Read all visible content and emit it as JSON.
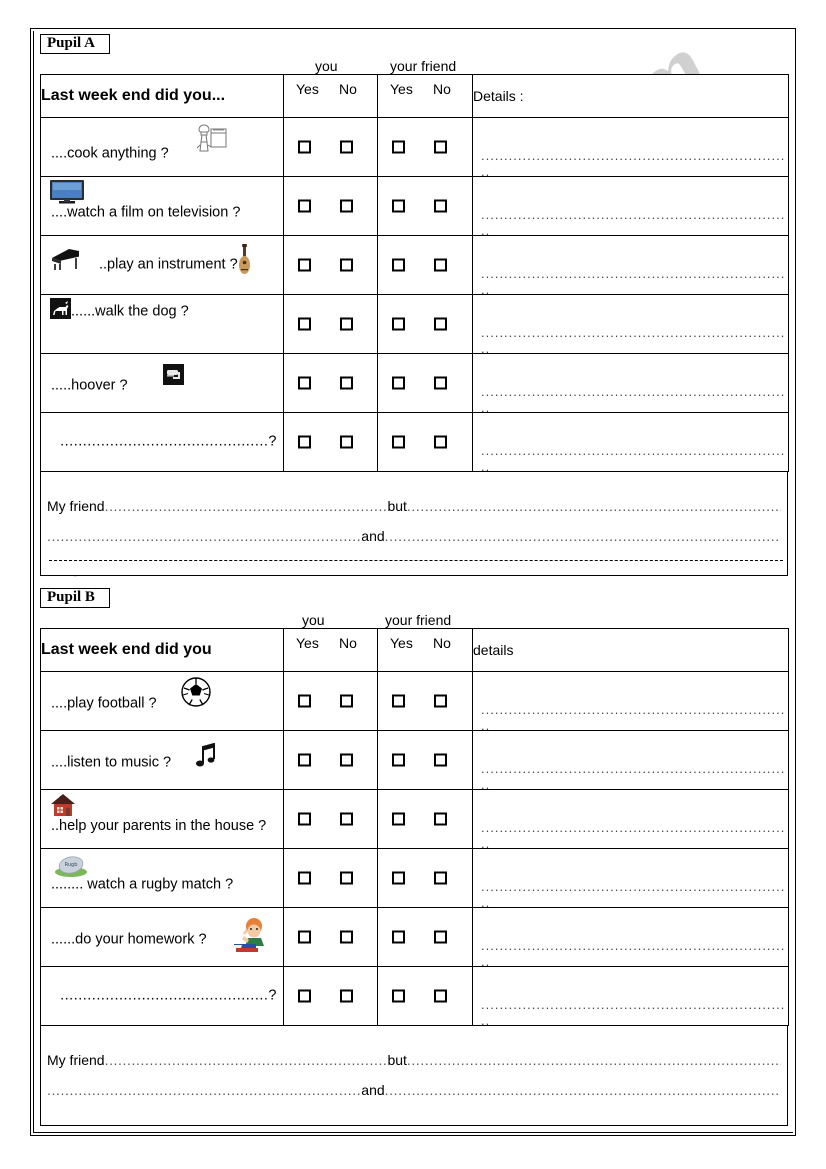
{
  "watermark": {
    "text": "ESLprintables.com"
  },
  "sections": [
    {
      "id": "a",
      "pupil_label": "Pupil A",
      "group_headers": {
        "you": "you",
        "your_friend": "your friend"
      },
      "table_header": {
        "question_col": "Last week end did you...",
        "you_yes": "Yes",
        "you_no": "No",
        "friend_yes": "Yes",
        "friend_no": "No",
        "details": "Details :"
      },
      "rows": [
        {
          "text": "....cook anything ?",
          "icons": [
            "chef-icon"
          ]
        },
        {
          "text": "....watch a film on television ?",
          "icons": [
            "television-icon"
          ]
        },
        {
          "text": "..play an instrument ?",
          "icons": [
            "piano-icon",
            "guitar-icon"
          ]
        },
        {
          "text": "......walk the dog ?",
          "icons": [
            "dog-icon"
          ]
        },
        {
          "text": ".....hoover ?",
          "icons": [
            "vacuum-icon"
          ]
        },
        {
          "text": "..............................................?",
          "icons": []
        }
      ],
      "details_dots": "..........................................................................................................",
      "details_dots_short": "..",
      "friend_summary": {
        "lead": "My friend",
        "dots1": "...............................................................",
        "but": "but",
        "dots2": "................................................................................................................................................................",
        "dots3": "......................................................................",
        "and": "and",
        "dots4": "......................................................................................................................",
        "has_dashed_separator": true
      }
    },
    {
      "id": "b",
      "pupil_label": "Pupil B",
      "group_headers": {
        "you": "you",
        "your_friend": "your friend"
      },
      "table_header": {
        "question_col": "Last week end did you",
        "you_yes": "Yes",
        "you_no": "No",
        "friend_yes": "Yes",
        "friend_no": "No",
        "details": "details"
      },
      "rows": [
        {
          "text": "....play football ?",
          "icons": [
            "football-icon"
          ]
        },
        {
          "text": "....listen to music ?",
          "icons": [
            "music-note-icon"
          ]
        },
        {
          "text": "..help your parents in the house ?",
          "icons": [
            "house-icon"
          ]
        },
        {
          "text": "........ watch a rugby match ?",
          "icons": [
            "rugby-ball-icon"
          ]
        },
        {
          "text": "......do your homework ?",
          "icons": [
            "homework-icon"
          ]
        },
        {
          "text": "..............................................?",
          "icons": []
        }
      ],
      "details_dots": "..........................................................................................................",
      "details_dots_short": "..",
      "friend_summary": {
        "lead": "My friend",
        "dots1": "...............................................................",
        "but": "but",
        "dots2": "................................................................................................................................................................",
        "dots3": "......................................................................",
        "and": "and",
        "dots4": "......................................................................................................................",
        "has_dashed_separator": false
      }
    }
  ]
}
